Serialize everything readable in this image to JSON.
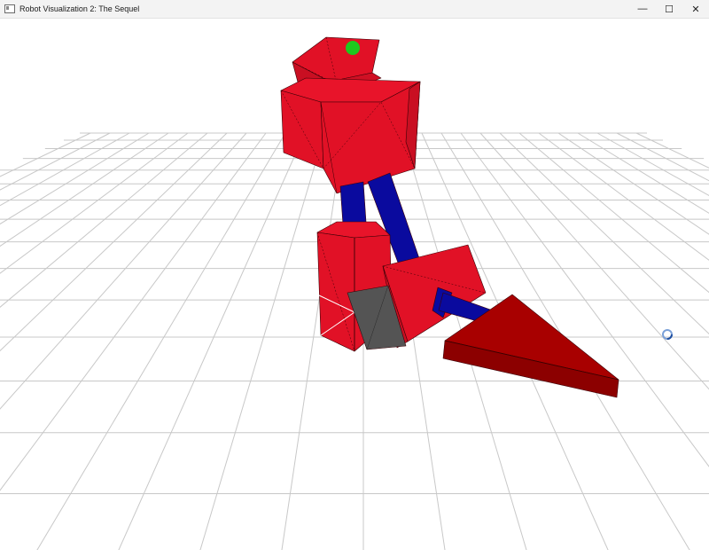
{
  "window": {
    "title": "Robot Visualization 2: The Sequel",
    "controls": {
      "minimize": "—",
      "maximize": "☐",
      "close": "✕"
    }
  },
  "scene": {
    "colors": {
      "body_red": "#e11126",
      "foot_dark_red": "#a80000",
      "joint_blue": "#0a0a9e",
      "knee_gray": "#545454",
      "eye_green": "#1ec81e",
      "grid_line": "#c8c8c8",
      "background": "#ffffff"
    },
    "icons": [
      "app-window-icon",
      "busy-spinner-icon"
    ]
  }
}
